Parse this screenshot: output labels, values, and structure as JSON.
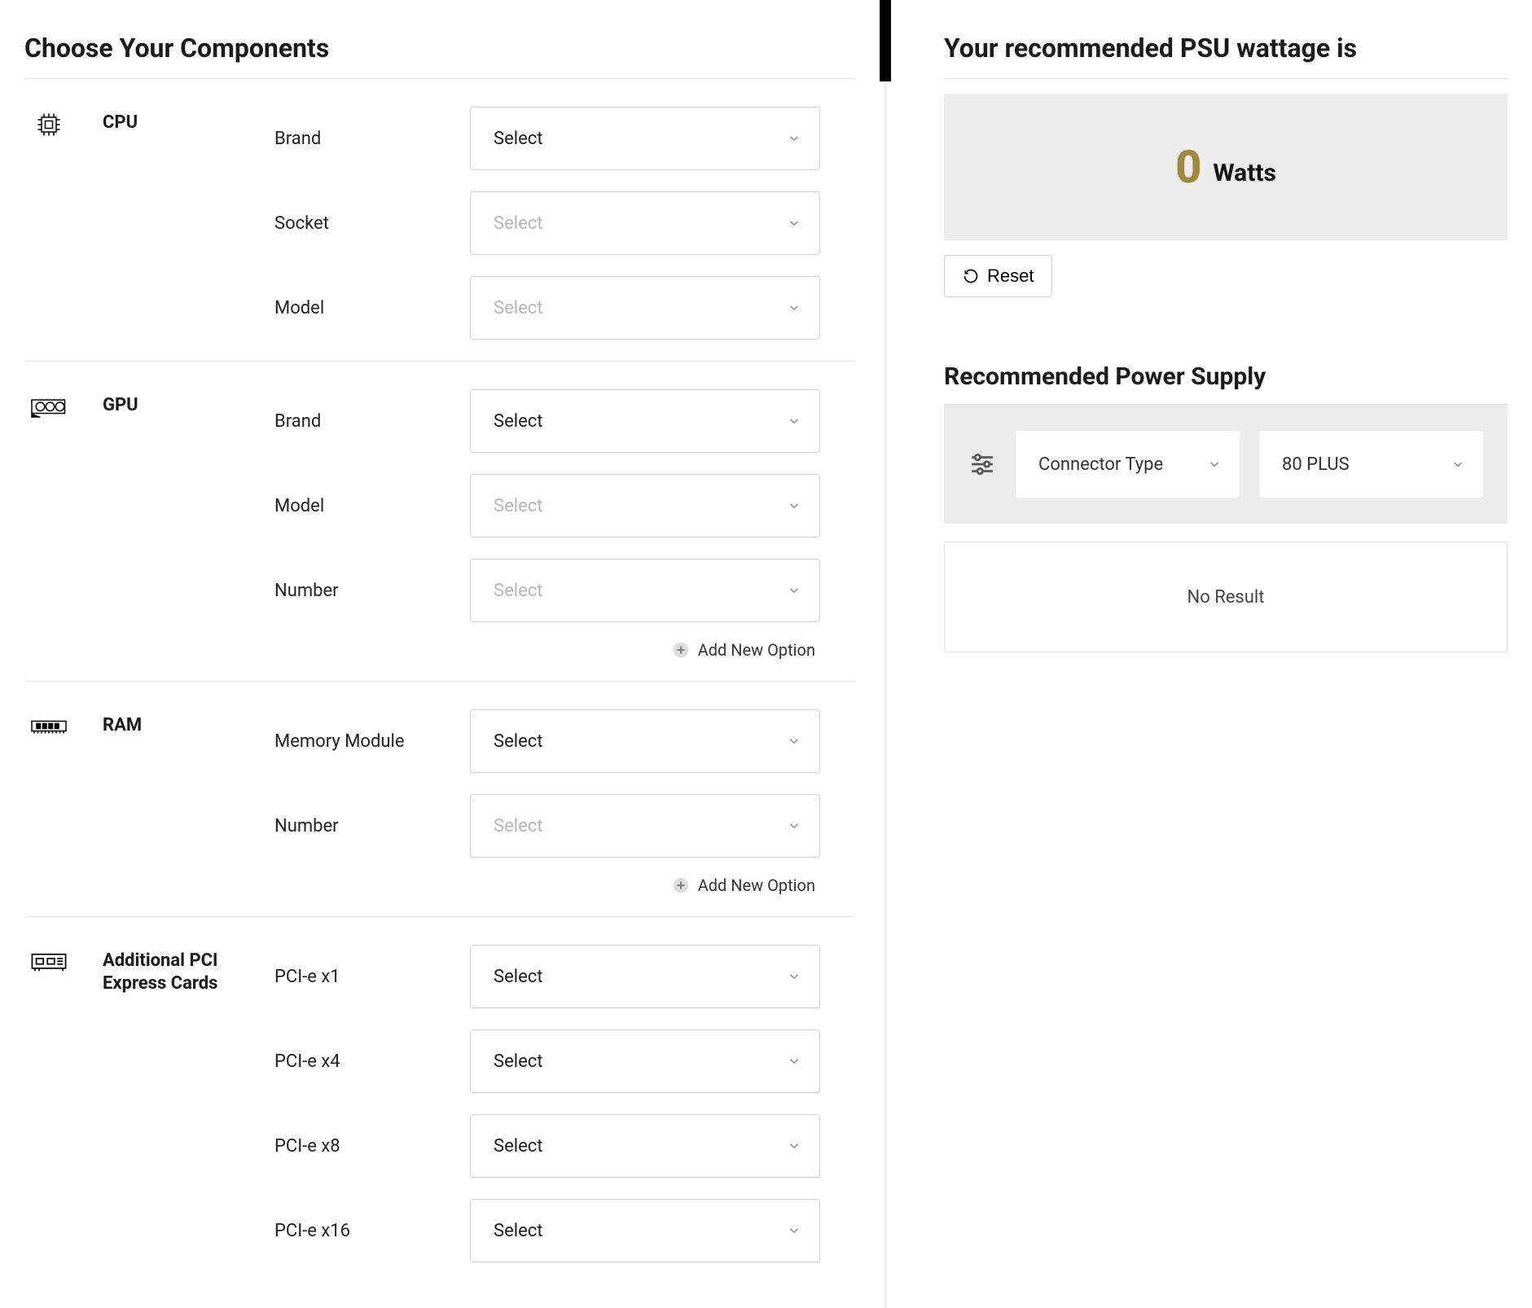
{
  "left": {
    "title": "Choose Your Components",
    "groups": {
      "cpu": {
        "name": "CPU",
        "fields": [
          {
            "label": "Brand",
            "value": "Select",
            "placeholder": false
          },
          {
            "label": "Socket",
            "value": "Select",
            "placeholder": true
          },
          {
            "label": "Model",
            "value": "Select",
            "placeholder": true
          }
        ]
      },
      "gpu": {
        "name": "GPU",
        "fields": [
          {
            "label": "Brand",
            "value": "Select",
            "placeholder": false
          },
          {
            "label": "Model",
            "value": "Select",
            "placeholder": true
          },
          {
            "label": "Number",
            "value": "Select",
            "placeholder": true
          }
        ],
        "add_label": "Add New Option"
      },
      "ram": {
        "name": "RAM",
        "fields": [
          {
            "label": "Memory Module",
            "value": "Select",
            "placeholder": false
          },
          {
            "label": "Number",
            "value": "Select",
            "placeholder": true
          }
        ],
        "add_label": "Add New Option"
      },
      "pcie": {
        "name": "Additional PCI Express Cards",
        "fields": [
          {
            "label": "PCI-e x1",
            "value": "Select",
            "placeholder": false
          },
          {
            "label": "PCI-e x4",
            "value": "Select",
            "placeholder": false
          },
          {
            "label": "PCI-e x8",
            "value": "Select",
            "placeholder": false
          },
          {
            "label": "PCI-e x16",
            "value": "Select",
            "placeholder": false
          }
        ]
      }
    }
  },
  "right": {
    "wattage_title": "Your recommended PSU wattage is",
    "wattage_value": "0",
    "wattage_unit": "Watts",
    "reset_label": "Reset",
    "recommended_title": "Recommended Power Supply",
    "filters": {
      "connector": "Connector Type",
      "rating": "80 PLUS"
    },
    "no_result": "No Result"
  }
}
